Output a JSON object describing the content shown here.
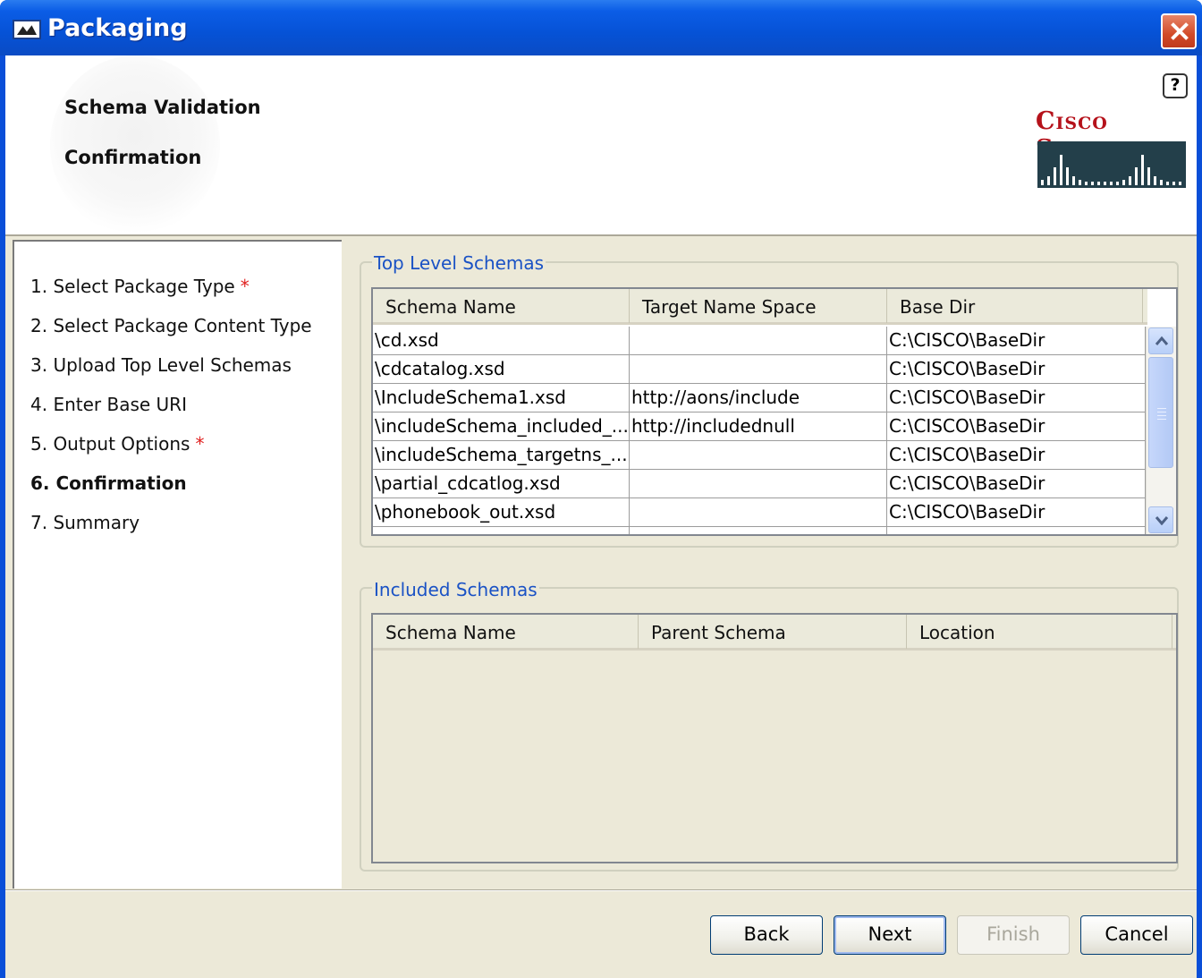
{
  "window": {
    "title": "Packaging",
    "close_label": "Close"
  },
  "header": {
    "titles": [
      "Schema Validation",
      "Confirmation"
    ],
    "help_label": "?",
    "logo_text": "Cisco Systems"
  },
  "sidebar": {
    "items": [
      {
        "label": "1. Select Package Type",
        "required": true,
        "active": false
      },
      {
        "label": "2. Select Package Content Type",
        "required": false,
        "active": false
      },
      {
        "label": "3. Upload Top Level Schemas",
        "required": false,
        "active": false
      },
      {
        "label": "4. Enter Base URI",
        "required": false,
        "active": false
      },
      {
        "label": "5. Output Options",
        "required": true,
        "active": false
      },
      {
        "label": "6. Confirmation",
        "required": false,
        "active": true
      },
      {
        "label": "7. Summary",
        "required": false,
        "active": false
      }
    ],
    "required_marker": "*"
  },
  "top_level_schemas": {
    "label": "Top Level Schemas",
    "columns": [
      "Schema Name",
      "Target Name Space",
      "Base Dir"
    ],
    "rows": [
      [
        "\\cd.xsd",
        "",
        "C:\\CISCO\\BaseDir"
      ],
      [
        "\\cdcatalog.xsd",
        "",
        "C:\\CISCO\\BaseDir"
      ],
      [
        "\\IncludeSchema1.xsd",
        "http://aons/include",
        "C:\\CISCO\\BaseDir"
      ],
      [
        "\\includeSchema_included_...",
        "http://includednull",
        "C:\\CISCO\\BaseDir"
      ],
      [
        "\\includeSchema_targetns_...",
        "",
        "C:\\CISCO\\BaseDir"
      ],
      [
        "\\partial_cdcatlog.xsd",
        "",
        "C:\\CISCO\\BaseDir"
      ],
      [
        "\\phonebook_out.xsd",
        "",
        "C:\\CISCO\\BaseDir"
      ]
    ]
  },
  "included_schemas": {
    "label": "Included Schemas",
    "columns": [
      "Schema Name",
      "Parent Schema",
      "Location"
    ],
    "rows": []
  },
  "buttons": {
    "back": "Back",
    "next": "Next",
    "finish": "Finish",
    "cancel": "Cancel"
  },
  "colors": {
    "title_bar": "#0652d6",
    "group_label": "#1a52c5",
    "required_marker": "#e0201f",
    "logo_red": "#b5121b"
  }
}
